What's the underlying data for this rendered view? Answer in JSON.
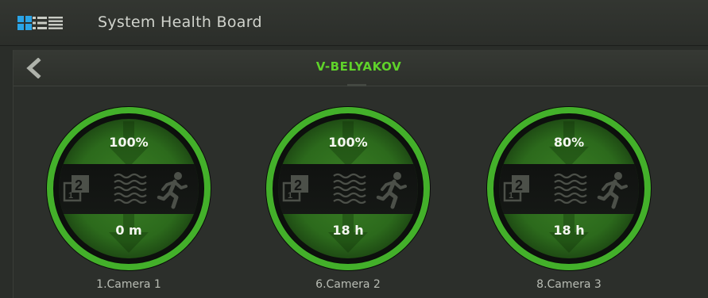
{
  "header": {
    "title": "System Health Board",
    "view_icons": [
      "grid-view-icon",
      "list-view-icon",
      "lines-view-icon"
    ],
    "active_view": "grid"
  },
  "server": {
    "name": "V-BELYAKOV",
    "name_color": "#5fd22a"
  },
  "cameras": [
    {
      "name": "1.Camera 1",
      "health": "100%",
      "time": "0 m"
    },
    {
      "name": "6.Camera 2",
      "health": "100%",
      "time": "18 h"
    },
    {
      "name": "8.Camera 3",
      "health": "80%",
      "time": "18 h"
    }
  ],
  "status_icons": [
    "multistream-icon",
    "noise-icon",
    "motion-icon"
  ],
  "colors": {
    "accent_blue": "#2aa4e6",
    "health_green": "#3fb021",
    "dark_bg": "#2a2d29"
  }
}
